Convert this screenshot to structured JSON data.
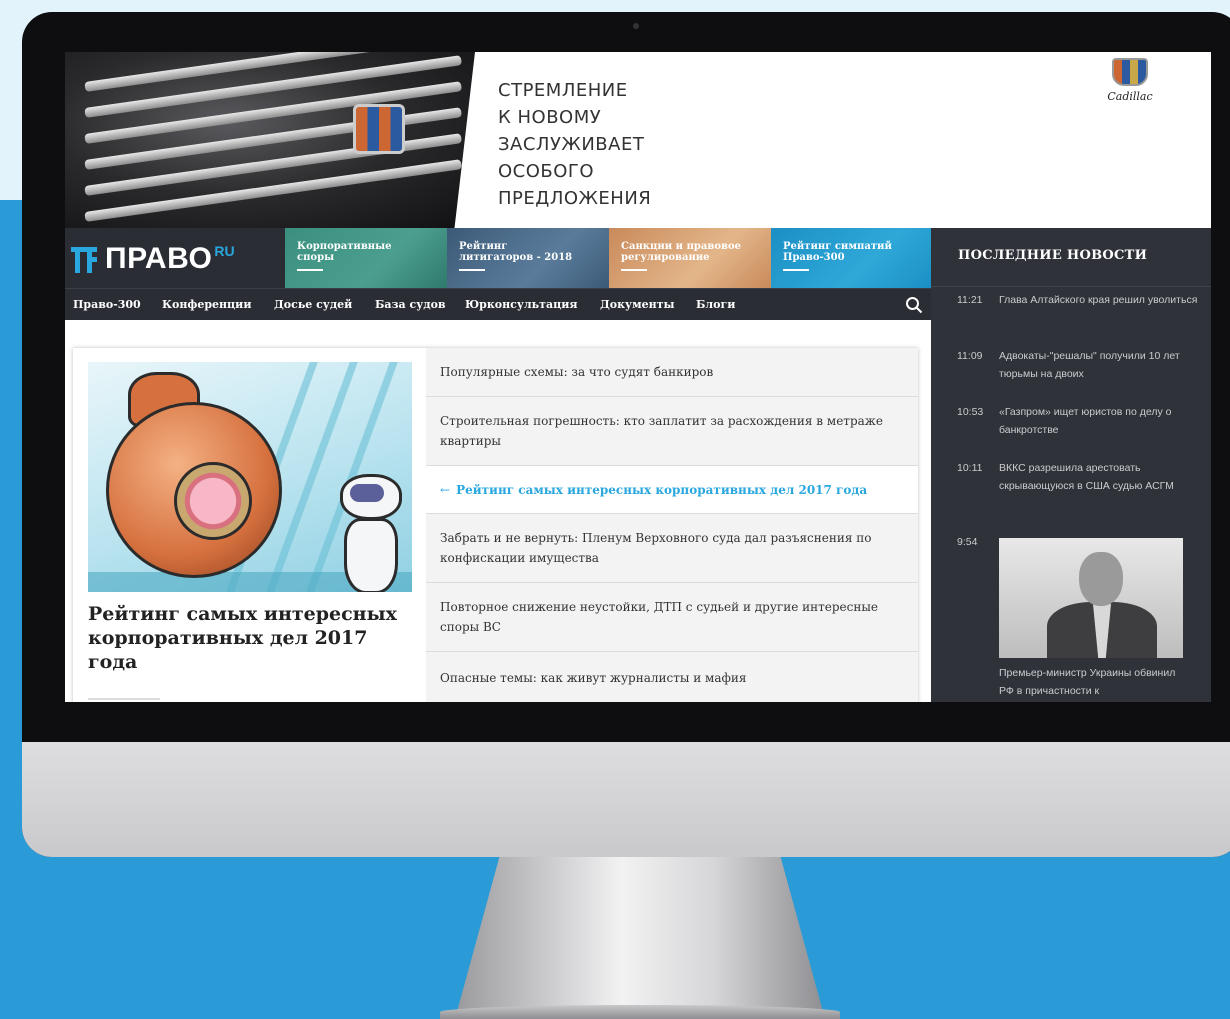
{
  "banner": {
    "lines": [
      "СТРЕМЛЕНИЕ",
      "К НОВОМУ",
      "ЗАСЛУЖИВАЕТ",
      "ОСОБОГО",
      "ПРЕДЛОЖЕНИЯ"
    ],
    "brand": "Cadillac"
  },
  "header": {
    "logo_text": "ПРАВО",
    "logo_sup": "RU",
    "promos": [
      {
        "line1": "Корпоративные",
        "line2": "споры",
        "color": "#3a8f7f"
      },
      {
        "line1": "Рейтинг",
        "line2": "литигаторов - 2018",
        "color": "#3b5a78"
      },
      {
        "line1": "Санкции и правовое",
        "line2": "регулирование",
        "color": "#c98a5a"
      },
      {
        "line1": "Рейтинг симпатий",
        "line2": "Право-300",
        "color": "#1b8fc4"
      }
    ]
  },
  "nav": {
    "items": [
      "Право-300",
      "Конференции",
      "Досье судей",
      "База судов",
      "Юрконсультация",
      "Документы",
      "Блоги"
    ],
    "search_icon": "search-icon"
  },
  "feature": {
    "title": "Рейтинг самых интересных корпоративных дел 2017 года"
  },
  "list": [
    {
      "text": "Популярные схемы: за что судят банкиров",
      "active": false
    },
    {
      "text": "Строительная погрешность: кто заплатит за расхождения в метраже квартиры",
      "active": false
    },
    {
      "text": "Рейтинг самых интересных корпоративных дел 2017 года",
      "active": true
    },
    {
      "text": "Забрать и не вернуть: Пленум Верховного суда дал разъяснения по конфискации имущества",
      "active": false
    },
    {
      "text": "Повторное снижение неустойки, ДТП с судьей и другие интересные споры ВС",
      "active": false
    },
    {
      "text": "Опасные темы: как живут журналисты и мафия",
      "active": false
    }
  ],
  "sidebar": {
    "title": "ПОСЛЕДНИЕ НОВОСТИ",
    "news": [
      {
        "time": "11:21",
        "text": "Глава Алтайского края решил уволиться"
      },
      {
        "time": "11:09",
        "text": "Адвокаты-\"решалы\" получили 10 лет тюрьмы на двоих"
      },
      {
        "time": "10:53",
        "text": "«Газпром» ищет юристов по делу о банкротстве"
      },
      {
        "time": "10:11",
        "text": "ВККС разрешила арестовать скрывающуюся в США судью АСГМ"
      },
      {
        "time": "9:54",
        "text": "Премьер-министр Украины обвинил РФ в причастности к"
      }
    ]
  },
  "colors": {
    "accent": "#29a7df",
    "dark_bar": "#2a2d33",
    "background": "#2a9bd6"
  }
}
